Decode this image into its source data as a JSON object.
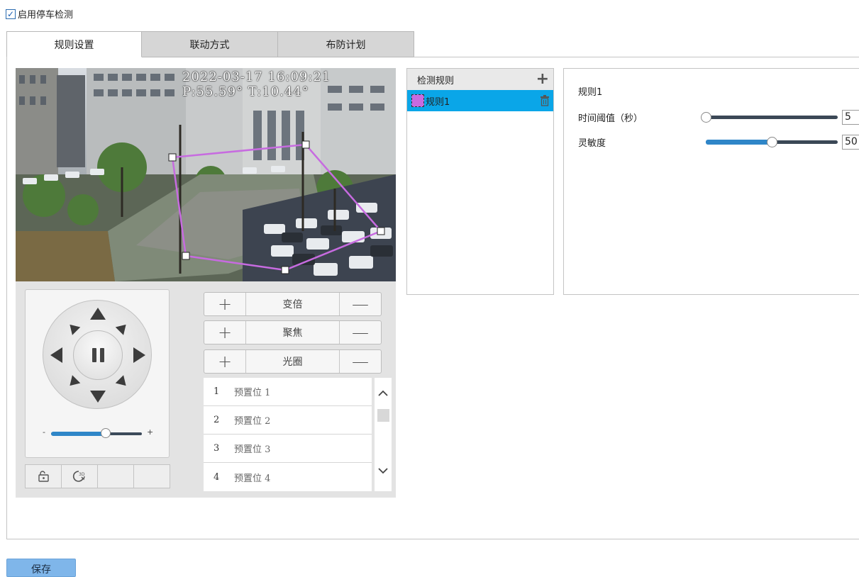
{
  "enable": {
    "label": "启用停车检测",
    "checked": true
  },
  "tabs": [
    {
      "label": "规则设置",
      "active": true
    },
    {
      "label": "联动方式",
      "active": false
    },
    {
      "label": "布防计划",
      "active": false
    }
  ],
  "video": {
    "osd_line1": "2022-03-17 16:09:21",
    "osd_line2": "P:55.59°  T:10.44°",
    "rule_polygon_color": "#c76be0"
  },
  "ptz": {
    "speed_level": 0.6,
    "controls": [
      {
        "plus": "+",
        "label": "变倍",
        "minus": "—"
      },
      {
        "plus": "+",
        "label": "聚焦",
        "minus": "—"
      },
      {
        "plus": "+",
        "label": "光圈",
        "minus": "—"
      }
    ],
    "speed_minus": "-",
    "speed_plus": "+",
    "presets": [
      {
        "num": "1",
        "name": "预置位 1"
      },
      {
        "num": "2",
        "name": "预置位 2"
      },
      {
        "num": "3",
        "name": "预置位 3"
      },
      {
        "num": "4",
        "name": "预置位 4"
      }
    ]
  },
  "rules": {
    "header": "检测规则",
    "items": [
      {
        "name": "规则1",
        "color": "#c76be0",
        "selected": true
      }
    ]
  },
  "params": {
    "title": "规则1",
    "time_threshold": {
      "label": "时间阈值（秒）",
      "value": "5",
      "fraction": 0.0
    },
    "sensitivity": {
      "label": "灵敏度",
      "value": "50",
      "fraction": 0.5
    }
  },
  "save_label": "保存",
  "colors": {
    "accent": "#0aa6e8",
    "save": "#7fb6ea",
    "slider": "#2f86c8"
  }
}
